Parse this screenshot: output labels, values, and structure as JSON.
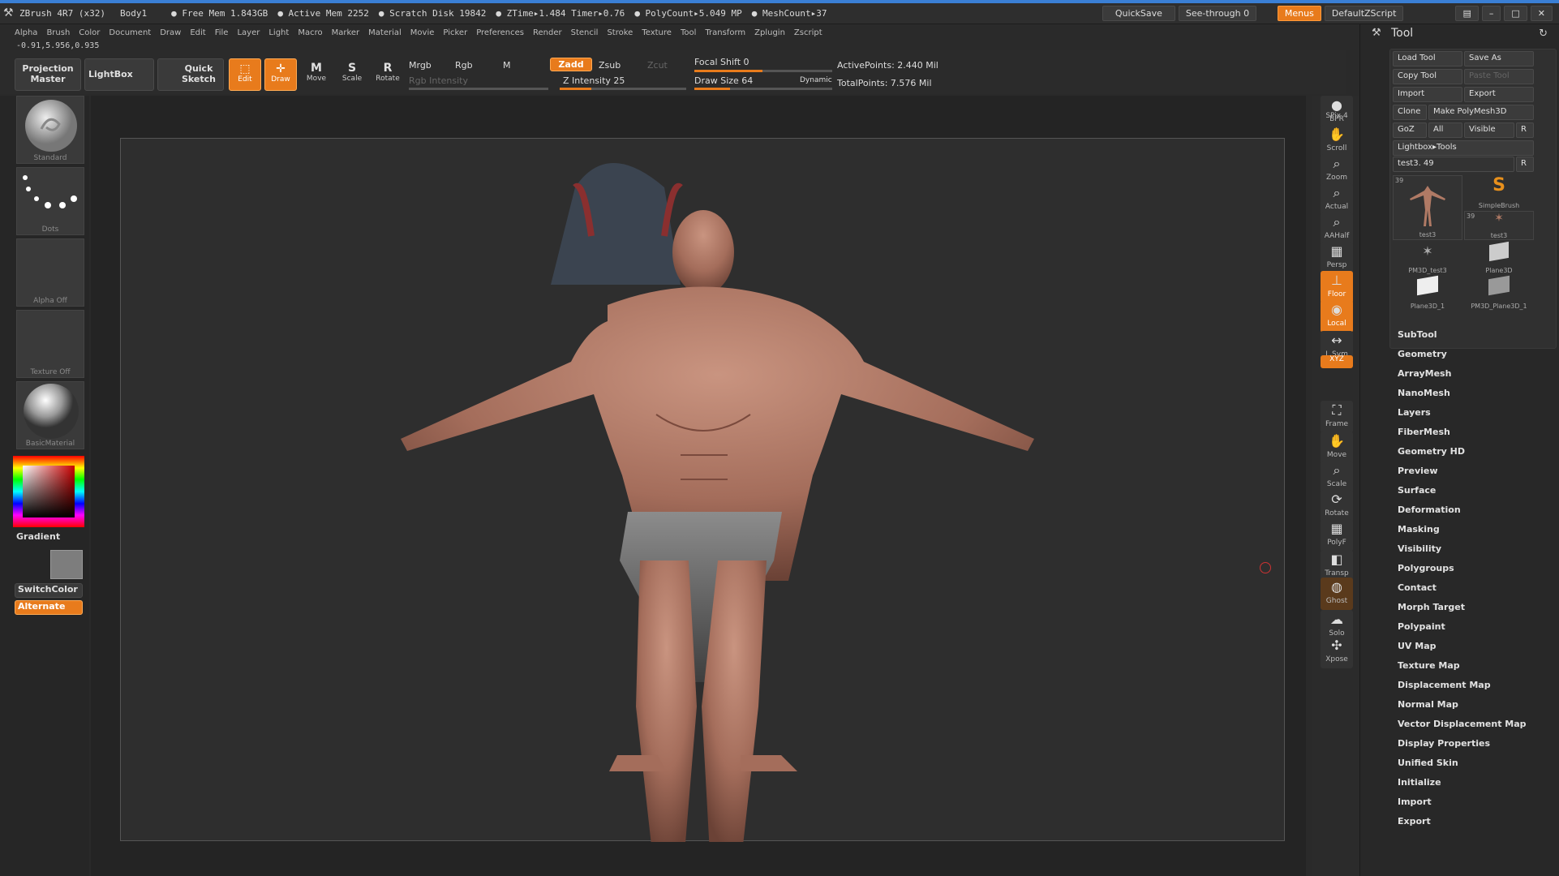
{
  "titlebar": {
    "app": "ZBrush 4R7 (x32)",
    "doc": "Body1",
    "free_mem": "● Free Mem 1.843GB",
    "active_mem": "● Active Mem 2252",
    "scratch": "● Scratch Disk 19842",
    "ztime": "● ZTime▸1.484 Timer▸0.76",
    "polycount": "● PolyCount▸5.049 MP",
    "meshcount": "● MeshCount▸37",
    "quicksave": "QuickSave",
    "seethrough": "See-through  0",
    "menus": "Menus",
    "zscript": "DefaultZScript"
  },
  "menubar": [
    "Alpha",
    "Brush",
    "Color",
    "Document",
    "Draw",
    "Edit",
    "File",
    "Layer",
    "Light",
    "Macro",
    "Marker",
    "Material",
    "Movie",
    "Picker",
    "Preferences",
    "Render",
    "Stencil",
    "Stroke",
    "Texture",
    "Tool",
    "Transform",
    "Zplugin",
    "Zscript"
  ],
  "coords": "-0.91,5.956,0.935",
  "toolbar": {
    "projection_master": "Projection Master",
    "lightbox": "LightBox",
    "quick_sketch": "Quick Sketch",
    "edit": "Edit",
    "draw": "Draw",
    "move": "Move",
    "scale": "Scale",
    "rotate": "Rotate",
    "mrgb": "Mrgb",
    "rgb": "Rgb",
    "m": "M",
    "zadd": "Zadd",
    "zsub": "Zsub",
    "zcut": "Zcut",
    "rgb_intensity": "Rgb Intensity",
    "z_intensity": "Z Intensity 25",
    "z_intensity_level": 0.25,
    "focal_shift": "Focal Shift 0",
    "draw_size": "Draw Size 64",
    "dynamic": "Dynamic",
    "active_points": "ActivePoints: 2.440  Mil",
    "total_points": "TotalPoints: 7.576  Mil"
  },
  "leftshelf": {
    "brush": "Standard",
    "stroke": "Dots",
    "alpha": "Alpha  Off",
    "texture": "Texture  Off",
    "material": "BasicMaterial",
    "gradient": "Gradient",
    "switchcolor": "SwitchColor",
    "alternate": "Alternate"
  },
  "rightshelf": [
    "BPR",
    "SPix 4",
    "Scroll",
    "Zoom",
    "Actual",
    "AAHalf",
    "Persp",
    "Floor",
    "Local",
    "L.Sym",
    "XYZ",
    "Frame",
    "Move",
    "Scale",
    "Rotate",
    "PolyF",
    "Transp",
    "Ghost",
    "Solo",
    "Xpose"
  ],
  "tray": {
    "title": "Tool",
    "load_tool": "Load Tool",
    "save_as": "Save As",
    "copy_tool": "Copy Tool",
    "paste_tool": "Paste Tool",
    "import": "Import",
    "export": "Export",
    "clone": "Clone",
    "make_polymesh": "Make PolyMesh3D",
    "goz": "GoZ",
    "all": "All",
    "visible": "Visible",
    "r": "R",
    "lightbox_tools": "Lightbox▸Tools",
    "current_tool": "test3. 49",
    "thumbs": [
      "test3",
      "SimpleBrush",
      "test3",
      "PM3D_test3",
      "Plane3D",
      "Plane3D_1",
      "PM3D_Plane3D_1"
    ],
    "thumb_count": "39",
    "sections": [
      "SubTool",
      "Geometry",
      "ArrayMesh",
      "NanoMesh",
      "Layers",
      "FiberMesh",
      "Geometry HD",
      "Preview",
      "Surface",
      "Deformation",
      "Masking",
      "Visibility",
      "Polygroups",
      "Contact",
      "Morph Target",
      "Polypaint",
      "UV Map",
      "Texture Map",
      "Displacement Map",
      "Normal Map",
      "Vector Displacement Map",
      "Display Properties",
      "Unified Skin",
      "Initialize",
      "Import",
      "Export"
    ]
  }
}
